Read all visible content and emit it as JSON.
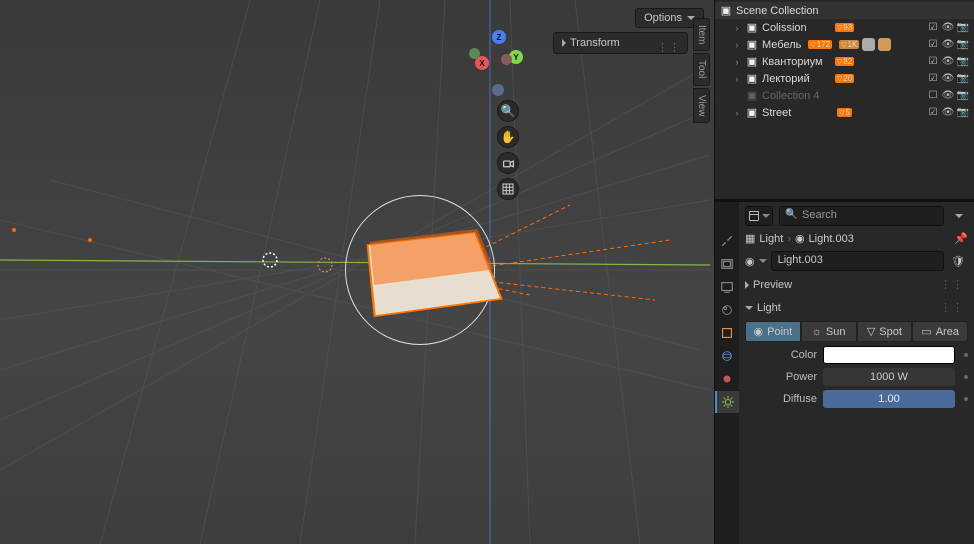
{
  "viewport": {
    "options_label": "Options",
    "transform_label": "Transform",
    "side_tabs": {
      "item": "Item",
      "tool": "Tool",
      "view": "View"
    },
    "gizmo": {
      "x": "X",
      "y": "Y",
      "z": "Z"
    }
  },
  "outliner": {
    "scene_root": "Scene Collection",
    "items": [
      {
        "label": "Colission",
        "count": "93",
        "dim": false,
        "expandable": true
      },
      {
        "label": "Мебель",
        "count": "172",
        "count2": "1K",
        "dim": false,
        "expandable": true,
        "extra": true
      },
      {
        "label": "Кванториум",
        "count": "82",
        "dim": false,
        "expandable": true
      },
      {
        "label": "Лекторий",
        "count": "20",
        "dim": false,
        "expandable": true
      },
      {
        "label": "Collection 4",
        "count": "",
        "dim": true,
        "expandable": false
      },
      {
        "label": "Street",
        "count": "5",
        "dim": false,
        "expandable": true
      }
    ]
  },
  "properties": {
    "search_placeholder": "Search",
    "breadcrumb": {
      "a": "Light",
      "b": "Light.003"
    },
    "data_name": "Light.003",
    "preview_label": "Preview",
    "light_label": "Light",
    "types": {
      "point": "Point",
      "sun": "Sun",
      "spot": "Spot",
      "area": "Area"
    },
    "rows": {
      "color_label": "Color",
      "power_label": "Power",
      "power_value": "1000 W",
      "diffuse_label": "Diffuse",
      "diffuse_value": "1.00"
    }
  }
}
